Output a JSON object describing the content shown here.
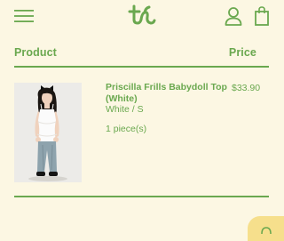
{
  "header": {
    "menu_icon": "hamburger-menu-icon",
    "logo_icon": "brand-logo",
    "account_icon": "user-account-icon",
    "cart_icon": "shopping-bag-icon"
  },
  "table": {
    "headers": {
      "product": "Product",
      "price": "Price"
    }
  },
  "cart_item": {
    "name": "Priscilla Frills Babydoll Top (White)",
    "variant": "White / S",
    "quantity": "1 piece(s)",
    "price": "$33.90",
    "image_icon": "product-photo"
  },
  "chat_widget": {
    "icon": "chat-icon"
  },
  "colors": {
    "background": "#fcf7e3",
    "accent": "#6aa84f",
    "chat": "#f6df8c"
  }
}
